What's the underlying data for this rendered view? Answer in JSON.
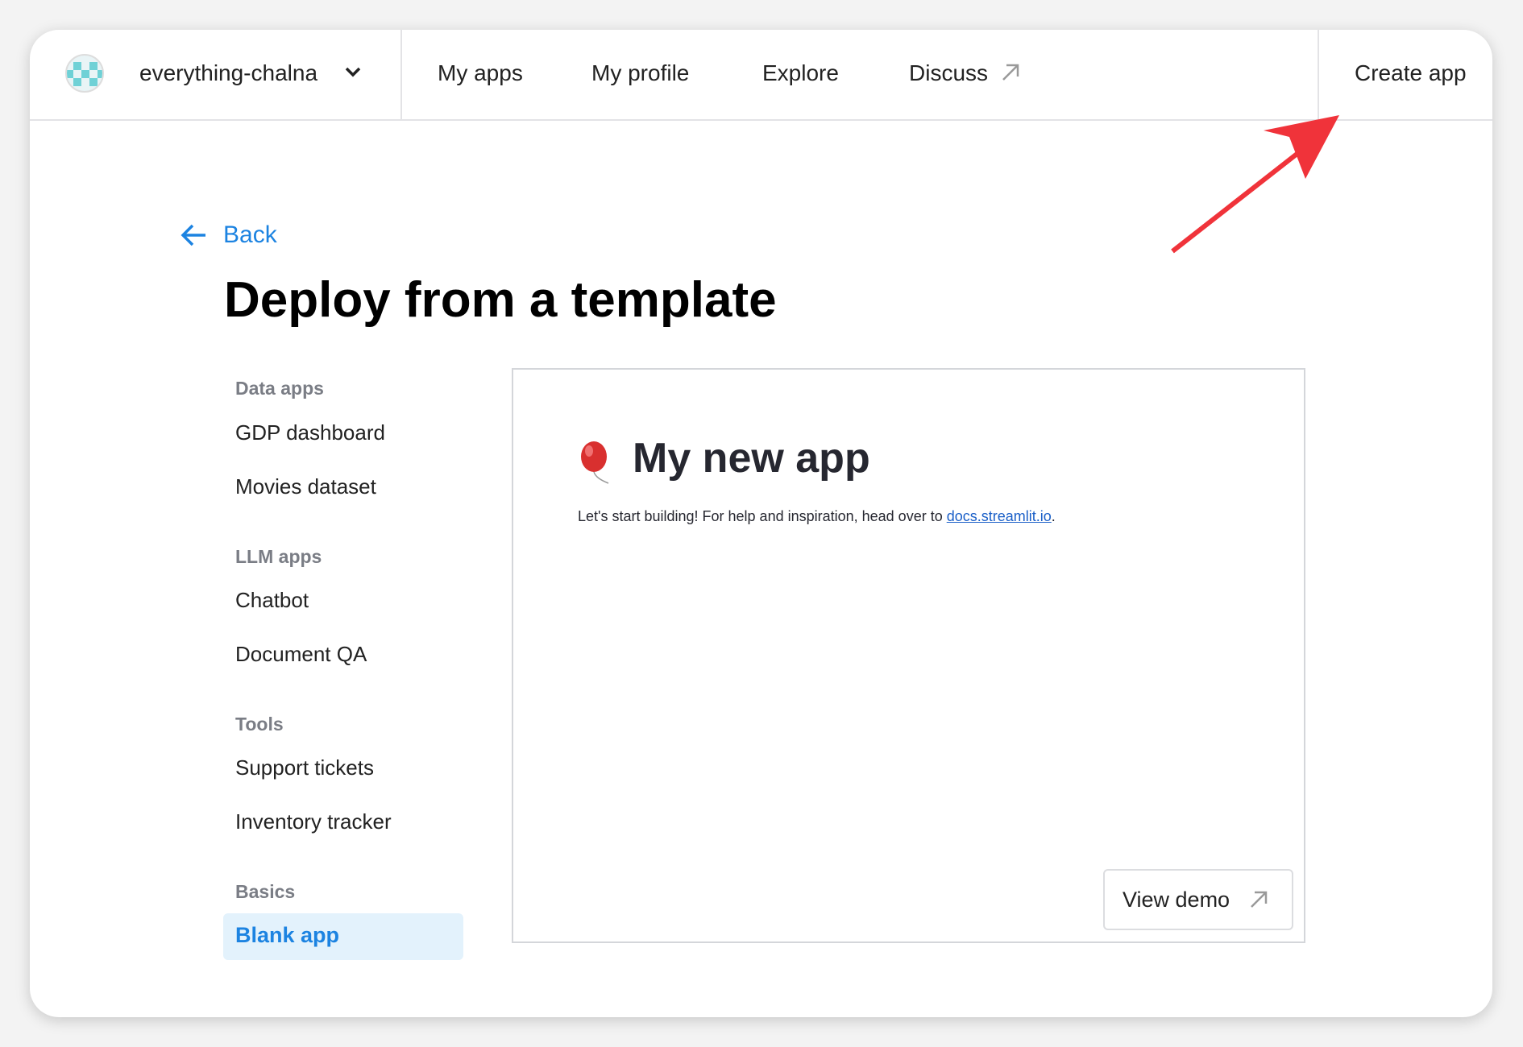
{
  "header": {
    "team": "everything-chalna",
    "nav": [
      "My apps",
      "My profile",
      "Explore",
      "Discuss"
    ],
    "create": "Create app"
  },
  "back": "Back",
  "title": "Deploy from a template",
  "sidebar": {
    "sections": [
      {
        "label": "Data apps",
        "items": [
          "GDP dashboard",
          "Movies dataset"
        ]
      },
      {
        "label": "LLM apps",
        "items": [
          "Chatbot",
          "Document QA"
        ]
      },
      {
        "label": "Tools",
        "items": [
          "Support tickets",
          "Inventory tracker"
        ]
      },
      {
        "label": "Basics",
        "items": [
          "Blank app"
        ]
      }
    ]
  },
  "preview": {
    "title": "My new app",
    "text": "Let's start building! For help and inspiration, head over to ",
    "link": "docs.streamlit.io",
    "after": ".",
    "demo": "View demo"
  },
  "colors": {
    "accent": "#1c83e1",
    "annotation": "#f0333a"
  }
}
